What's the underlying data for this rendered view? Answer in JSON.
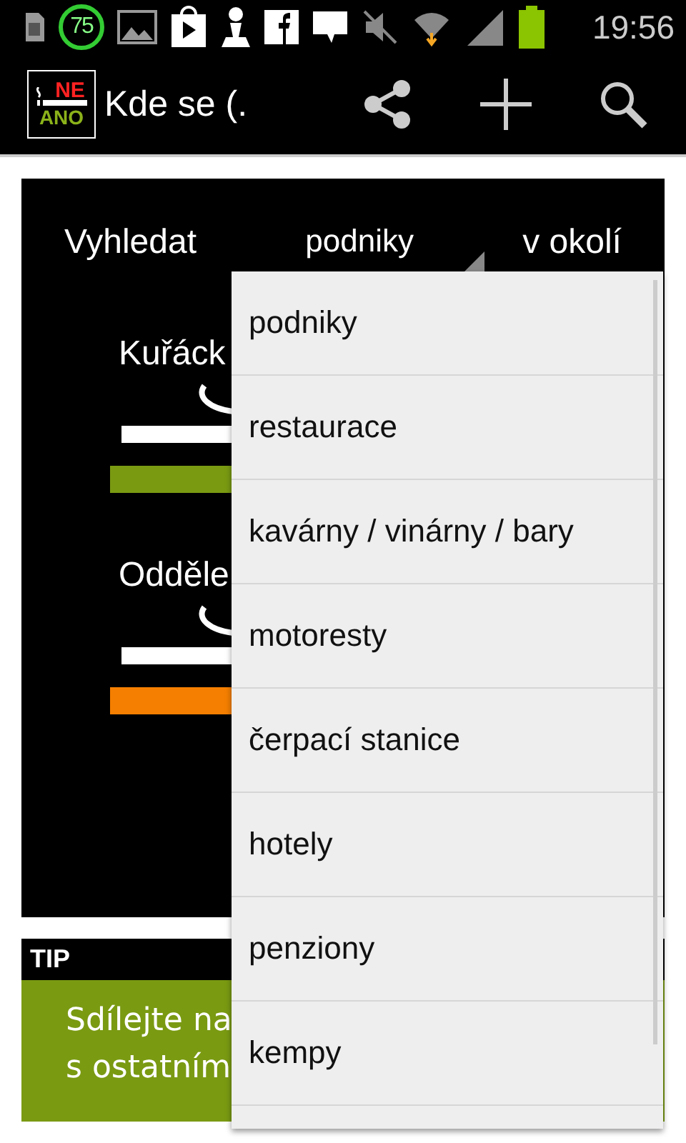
{
  "status_bar": {
    "badge": "75",
    "time": "19:56"
  },
  "action_bar": {
    "logo_top": "NE",
    "logo_bottom": "ANO",
    "title": "Kde se (."
  },
  "search": {
    "label": "Vyhledat",
    "value": "podniky",
    "suffix": "v okolí"
  },
  "sections": [
    {
      "title": "Kuřáck",
      "color": "#7a9a12"
    },
    {
      "title": "Odděle",
      "color": "#f57f00"
    }
  ],
  "tip": {
    "heading": "TIP",
    "lines": [
      "Sdílejte na",
      "s ostatním"
    ]
  },
  "dropdown": {
    "items": [
      "podniky",
      "restaurace",
      "kavárny / vinárny / bary",
      "motoresty",
      "čerpací stanice",
      "hotely",
      "penziony",
      "kempy"
    ]
  }
}
